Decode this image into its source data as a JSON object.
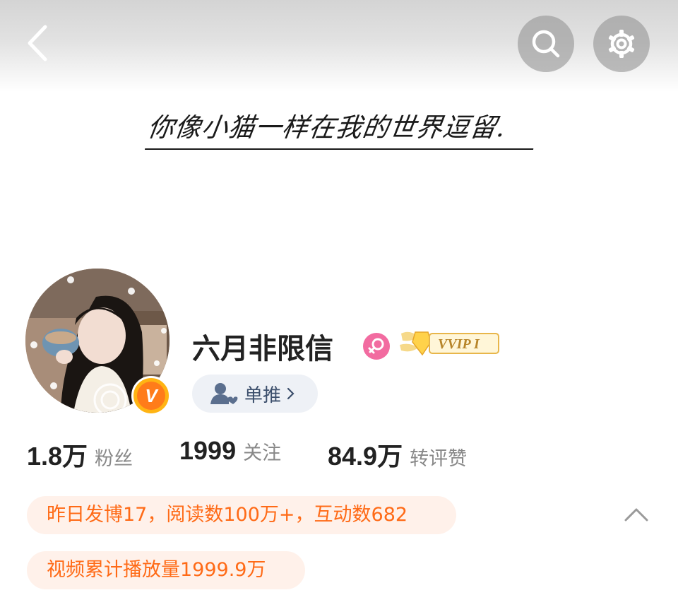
{
  "header": {
    "back_icon": "chevron-left-icon",
    "search_icon": "search-icon",
    "settings_icon": "gear-icon"
  },
  "banner": {
    "text": "你像小猫一样在我的世界逗留."
  },
  "profile": {
    "username": "六月非限信",
    "gender": "female",
    "vip_level_label": "VVIP I",
    "verified_badge_letter": "V",
    "recommend_label": "单推",
    "colors": {
      "gender_pink": "#f26ba0",
      "vip_gold": "#ffb413",
      "vip_orange": "#ff7c1a"
    }
  },
  "stats": [
    {
      "value": "1.8万",
      "label": "粉丝"
    },
    {
      "value": "1999",
      "label": "关注"
    },
    {
      "value": "84.9万",
      "label": "转评赞"
    }
  ],
  "info": {
    "yesterday": "昨日发博17，阅读数100万+，互动数682",
    "video": "视频累计播放量1999.9万",
    "accent_color": "#ff6a16",
    "collapse_icon": "chevron-up-icon"
  }
}
